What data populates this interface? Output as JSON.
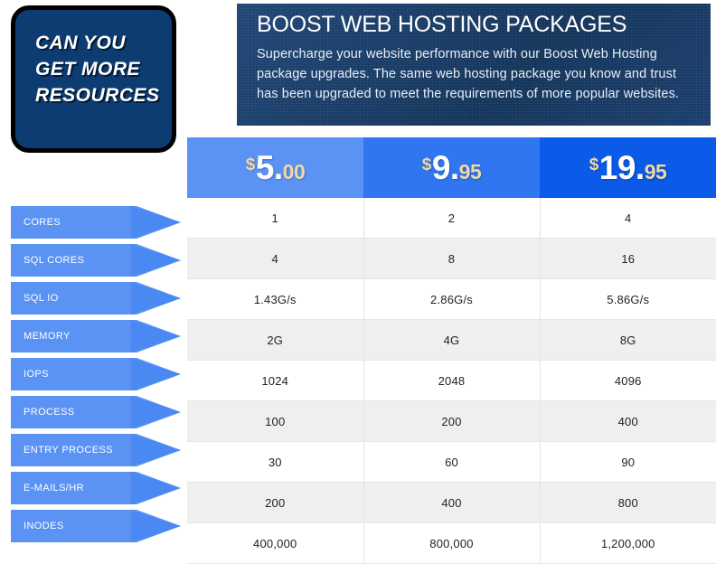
{
  "promo": {
    "lines": [
      "CAN YOU",
      "GET MORE",
      "RESOURCES"
    ]
  },
  "header": {
    "title": "BOOST WEB HOSTING PACKAGES",
    "description": "Supercharge your website performance with our Boost Web Hosting package upgrades. The same web hosting package you know and trust has been upgraded to meet the requirements of more popular websites."
  },
  "plans": [
    {
      "currency": "$",
      "whole": "5",
      "dot": ".",
      "cents": "00",
      "bg": "#5b93f5"
    },
    {
      "currency": "$",
      "whole": "9",
      "dot": ".",
      "cents": "95",
      "bg": "#2f76f0"
    },
    {
      "currency": "$",
      "whole": "19",
      "dot": ".",
      "cents": "95",
      "bg": "#0b5ae8"
    }
  ],
  "rows": [
    {
      "label": "CORES",
      "values": [
        "1",
        "2",
        "4"
      ]
    },
    {
      "label": "SQL CORES",
      "values": [
        "4",
        "8",
        "16"
      ]
    },
    {
      "label": "SQL IO",
      "values": [
        "1.43G/s",
        "2.86G/s",
        "5.86G/s"
      ]
    },
    {
      "label": "MEMORY",
      "values": [
        "2G",
        "4G",
        "8G"
      ]
    },
    {
      "label": "IOPS",
      "values": [
        "1024",
        "2048",
        "4096"
      ]
    },
    {
      "label": "PROCESS",
      "values": [
        "100",
        "200",
        "400"
      ]
    },
    {
      "label": "ENTRY PROCESS",
      "values": [
        "30",
        "60",
        "90"
      ]
    },
    {
      "label": "E-MAILS/HR",
      "values": [
        "200",
        "400",
        "800"
      ]
    },
    {
      "label": "INODES",
      "values": [
        "400,000",
        "800,000",
        "1,200,000"
      ]
    }
  ],
  "colors": {
    "badge_bg": "#0c3c72",
    "banner_bg": "#1b4070",
    "arrow_body": "#5b93f5",
    "arrow_tip": "#4a88f2",
    "price_accent": "#efd9a4",
    "row_alt_bg": "#efefef"
  }
}
